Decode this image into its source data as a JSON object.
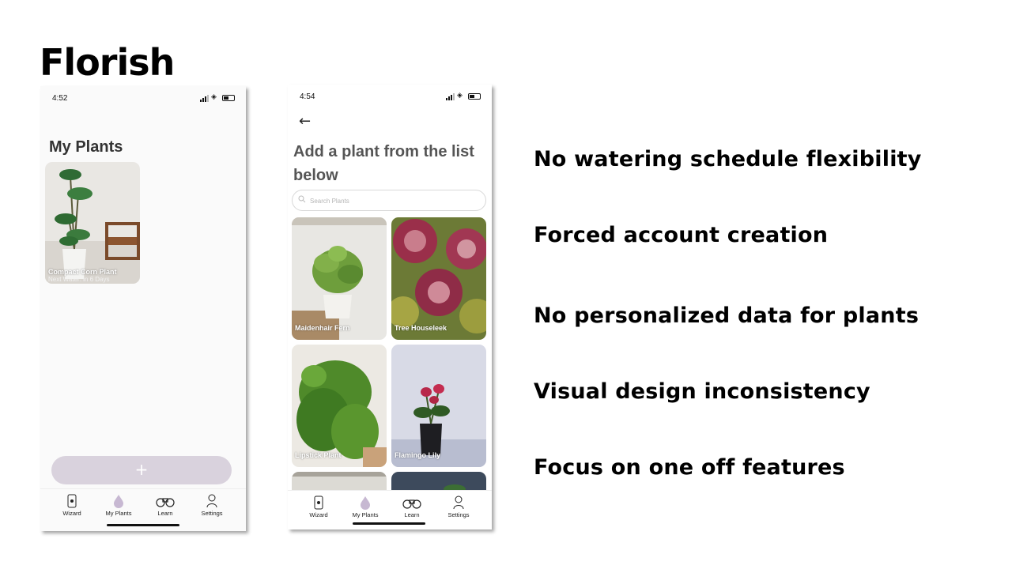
{
  "slide": {
    "title": "Florish",
    "points": [
      "No watering schedule flexibility",
      "Forced account creation",
      "No personalized data for plants",
      "Visual design inconsistency",
      "Focus on one off features"
    ]
  },
  "phone1": {
    "time": "4:52",
    "screen_title": "My Plants",
    "plants": [
      {
        "name": "Compact Corn Plant",
        "subtitle": "Next Water: in 6 Days"
      }
    ],
    "add_label": "+"
  },
  "phone2": {
    "time": "4:54",
    "heading": "Add a plant from the list below",
    "search_placeholder": "Search Plants",
    "plants": [
      {
        "name": "Maidenhair Fern"
      },
      {
        "name": "Tree Houseleek"
      },
      {
        "name": "Lipstick Plant"
      },
      {
        "name": "Flamingo Lily"
      }
    ]
  },
  "tabs": [
    {
      "label": "Wizard",
      "icon": "phone-icon"
    },
    {
      "label": "My Plants",
      "icon": "water-drop-icon"
    },
    {
      "label": "Learn",
      "icon": "binoculars-icon"
    },
    {
      "label": "Settings",
      "icon": "person-icon"
    }
  ],
  "colors": {
    "accent": "#c7b8d2",
    "add_button": "#d9d2dd"
  }
}
